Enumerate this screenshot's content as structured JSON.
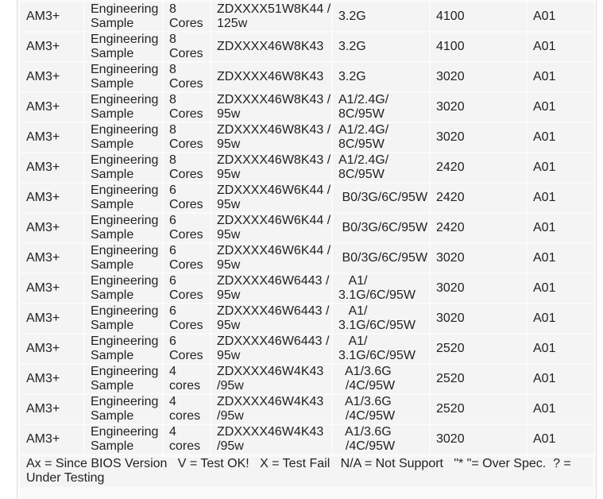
{
  "rows": [
    [
      "AM3+",
      "Engineering\nSample",
      "8\nCores",
      "ZDXXXX51W8K44 /\n125w",
      "3.2G",
      "4100",
      "A01"
    ],
    [
      "AM3+",
      "Engineering\nSample",
      "8\nCores",
      "ZDXXXX46W8K43",
      "3.2G",
      "4100",
      "A01"
    ],
    [
      "AM3+",
      "Engineering\nSample",
      "8\nCores",
      "ZDXXXX46W8K43",
      "3.2G",
      "3020",
      "A01"
    ],
    [
      "AM3+",
      "Engineering\nSample",
      "8\nCores",
      "ZDXXXX46W8K43 /\n95w",
      "A1/2.4G/\n8C/95W",
      "3020",
      "A01"
    ],
    [
      "AM3+",
      "Engineering\nSample",
      "8\nCores",
      "ZDXXXX46W8K43 /\n95w",
      "A1/2.4G/\n8C/95W",
      "3020",
      "A01"
    ],
    [
      "AM3+",
      "Engineering\nSample",
      "8\nCores",
      "ZDXXXX46W8K43 /\n95w",
      "A1/2.4G/\n8C/95W",
      "2420",
      "A01"
    ],
    [
      "AM3+",
      "Engineering\nSample",
      "6\nCores",
      "ZDXXXX46W6K44 /\n95w",
      " B0/3G/6C/95W",
      "2420",
      "A01"
    ],
    [
      "AM3+",
      "Engineering\nSample",
      "6\nCores",
      "ZDXXXX46W6K44 /\n95w",
      " B0/3G/6C/95W",
      "2420",
      "A01"
    ],
    [
      "AM3+",
      "Engineering\nSample",
      "6\nCores",
      "ZDXXXX46W6K44 /\n95w",
      " B0/3G/6C/95W",
      "3020",
      "A01"
    ],
    [
      "AM3+",
      "Engineering\nSample",
      "6\nCores",
      "ZDXXXX46W6443 /\n95w",
      "   A1/\n3.1G/6C/95W",
      "3020",
      "A01"
    ],
    [
      "AM3+",
      "Engineering\nSample",
      "6\nCores",
      "ZDXXXX46W6443 /\n95w",
      "   A1/\n3.1G/6C/95W",
      "3020",
      "A01"
    ],
    [
      "AM3+",
      "Engineering\nSample",
      "6\nCores",
      "ZDXXXX46W6443 /\n95w",
      "   A1/\n3.1G/6C/95W",
      "2520",
      "A01"
    ],
    [
      "AM3+",
      "Engineering\nSample",
      "4\ncores",
      "ZDXXXX46W4K43\n/95w",
      "  A1/3.6G\n  /4C/95W",
      "2520",
      "A01"
    ],
    [
      "AM3+",
      "Engineering\nSample",
      "4\ncores",
      "ZDXXXX46W4K43\n/95w",
      "  A1/3.6G\n  /4C/95W",
      "2520",
      "A01"
    ],
    [
      "AM3+",
      "Engineering\nSample",
      "4\ncores",
      "ZDXXXX46W4K43\n/95w",
      "  A1/3.6G\n  /4C/95W",
      "3020",
      "A01"
    ]
  ],
  "legend": "Ax = Since BIOS Version   V = Test OK!   X = Test Fail   N/A = Not Support   \"* \"= Over Spec.  ? = Under Testing"
}
